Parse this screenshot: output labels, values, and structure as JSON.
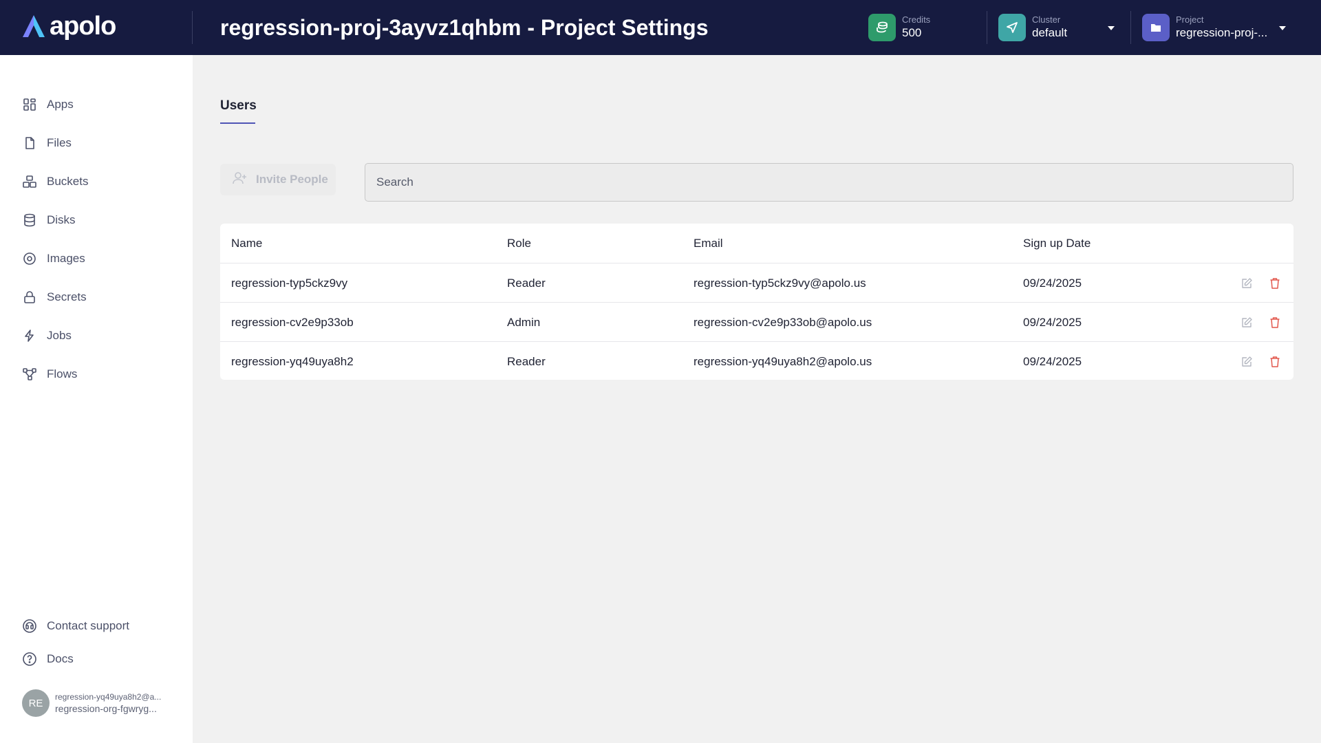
{
  "app": {
    "logo_text": "apolo"
  },
  "header": {
    "title": "regression-proj-3ayvz1qhbm - Project Settings",
    "credits": {
      "label": "Credits",
      "value": "500",
      "color": "#2e9b6b"
    },
    "cluster": {
      "label": "Cluster",
      "value": "default",
      "color": "#3fa6a6"
    },
    "project": {
      "label": "Project",
      "value": "regression-proj-...",
      "color": "#5b5fc7"
    }
  },
  "sidebar": {
    "items": [
      {
        "label": "Apps",
        "icon": "apps-grid-icon"
      },
      {
        "label": "Files",
        "icon": "file-icon"
      },
      {
        "label": "Buckets",
        "icon": "buckets-icon"
      },
      {
        "label": "Disks",
        "icon": "database-icon"
      },
      {
        "label": "Images",
        "icon": "disc-icon"
      },
      {
        "label": "Secrets",
        "icon": "lock-icon"
      },
      {
        "label": "Jobs",
        "icon": "lightning-icon"
      },
      {
        "label": "Flows",
        "icon": "flow-icon"
      }
    ],
    "footer": [
      {
        "label": "Contact support",
        "icon": "headset-icon"
      },
      {
        "label": "Docs",
        "icon": "help-circle-icon"
      }
    ],
    "user": {
      "initials": "RE",
      "email": "regression-yq49uya8h2@a...",
      "org": "regression-org-fgwryg..."
    }
  },
  "main": {
    "tabs": [
      {
        "label": "Users",
        "active": true
      }
    ],
    "invite_label": "Invite People",
    "search_placeholder": "Search",
    "table": {
      "headers": [
        "Name",
        "Role",
        "Email",
        "Sign up Date"
      ],
      "rows": [
        {
          "name": "regression-typ5ckz9vy",
          "role": "Reader",
          "email": "regression-typ5ckz9vy@apolo.us",
          "date": "09/24/2025"
        },
        {
          "name": "regression-cv2e9p33ob",
          "role": "Admin",
          "email": "regression-cv2e9p33ob@apolo.us",
          "date": "09/24/2025"
        },
        {
          "name": "regression-yq49uya8h2",
          "role": "Reader",
          "email": "regression-yq49uya8h2@apolo.us",
          "date": "09/24/2025"
        }
      ]
    }
  },
  "colors": {
    "header_bg": "#161b40",
    "accent": "#4f54b5",
    "delete": "#e2574c"
  }
}
